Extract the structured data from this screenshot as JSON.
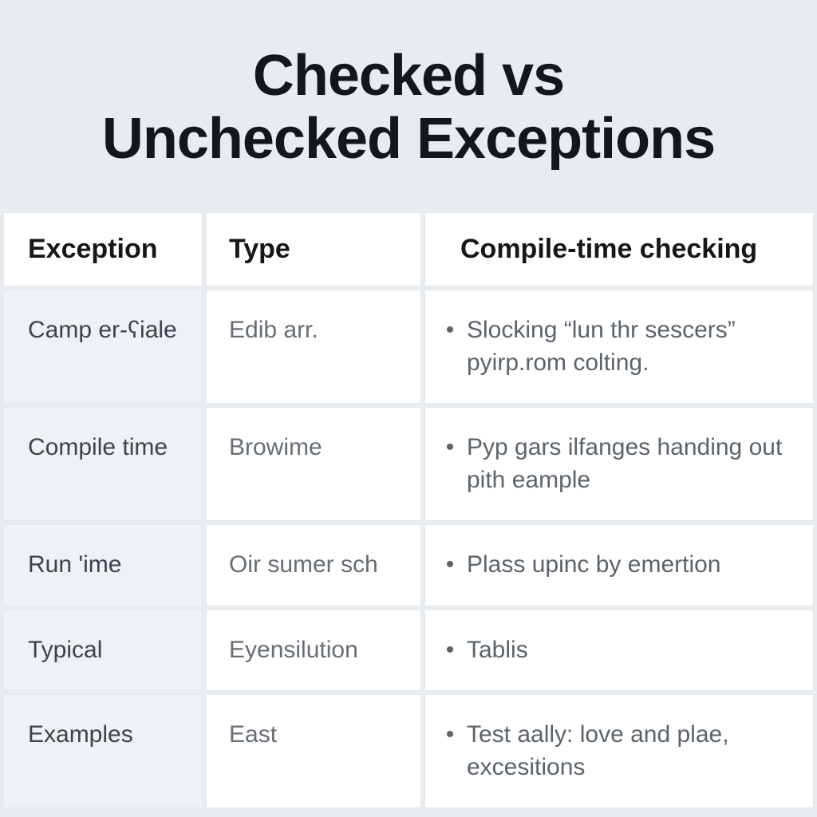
{
  "header": {
    "title_line1": "Checked vs",
    "title_line2": "Unchecked Exceptions"
  },
  "table": {
    "columns": {
      "exception": "Exception",
      "type": "Type",
      "checking": "Compile-time checking"
    },
    "rows": [
      {
        "exception": "Camp er-ʕiale",
        "type": "Edib arr.",
        "checking": "Slocking “lun thr sescers” pyirp.rom colting."
      },
      {
        "exception": "Compile time",
        "type": "Browime",
        "checking": "Pyp gars ilfanges handing out pith eample"
      },
      {
        "exception": "Run 'ime",
        "type": "Oir sumer sch",
        "checking": "Plass upinc by emertion"
      },
      {
        "exception": "Typical",
        "type": "Eyensilution",
        "checking": "Tablis"
      },
      {
        "exception": "Examples",
        "type": "East",
        "checking": "Test aally: love and plae, excesitions"
      }
    ]
  }
}
